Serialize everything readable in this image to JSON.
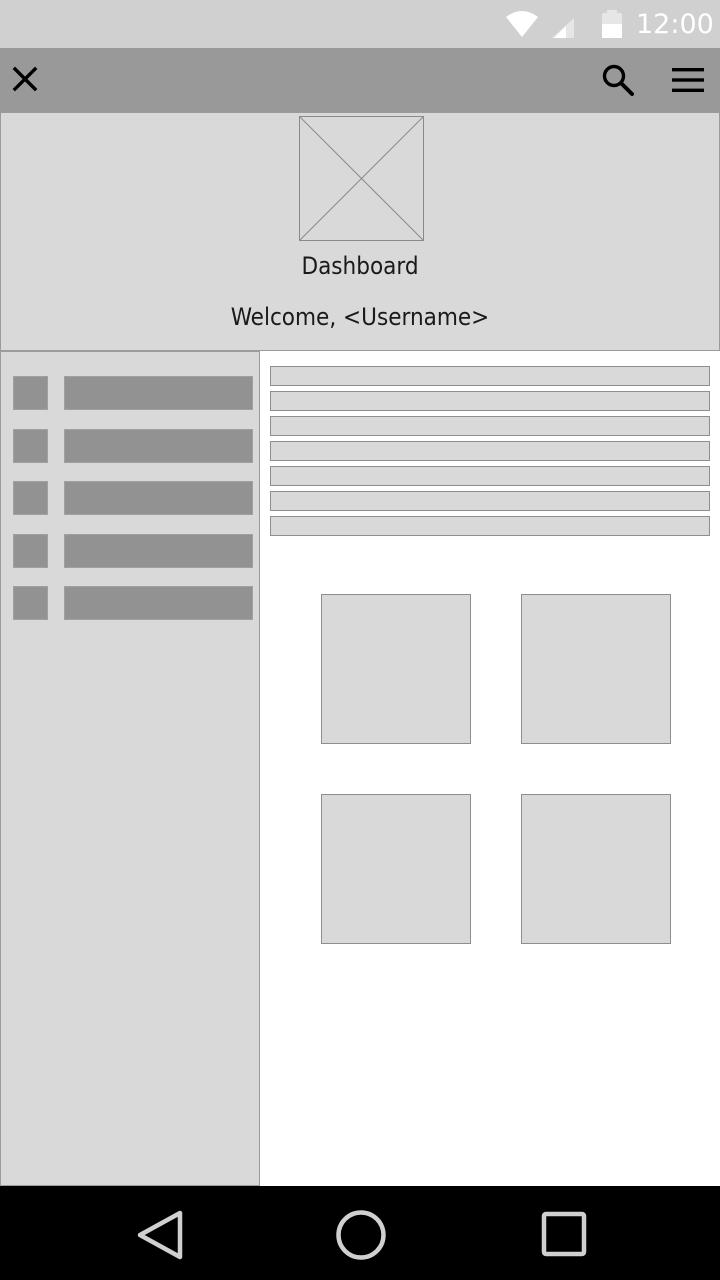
{
  "status_bar": {
    "time": "12:00",
    "icons": [
      "wifi-icon",
      "signal-icon",
      "battery-icon"
    ]
  },
  "toolbar": {
    "icons": [
      "close-icon",
      "search-icon",
      "menu-icon"
    ]
  },
  "header": {
    "image_icon": "image-placeholder-icon",
    "title": "Dashboard",
    "welcome": "Welcome, <Username>"
  },
  "sidebar": {
    "item_count": 5
  },
  "main": {
    "list_row_count": 7,
    "tile_count": 4
  },
  "nav_bar": {
    "icons": [
      "back-icon",
      "home-icon",
      "recents-icon"
    ]
  },
  "colors": {
    "status_bar": "#d0d0d0",
    "toolbar": "#999999",
    "panel": "#d9d9d9",
    "placeholder_dark": "#929292",
    "nav_bar": "#000000"
  }
}
